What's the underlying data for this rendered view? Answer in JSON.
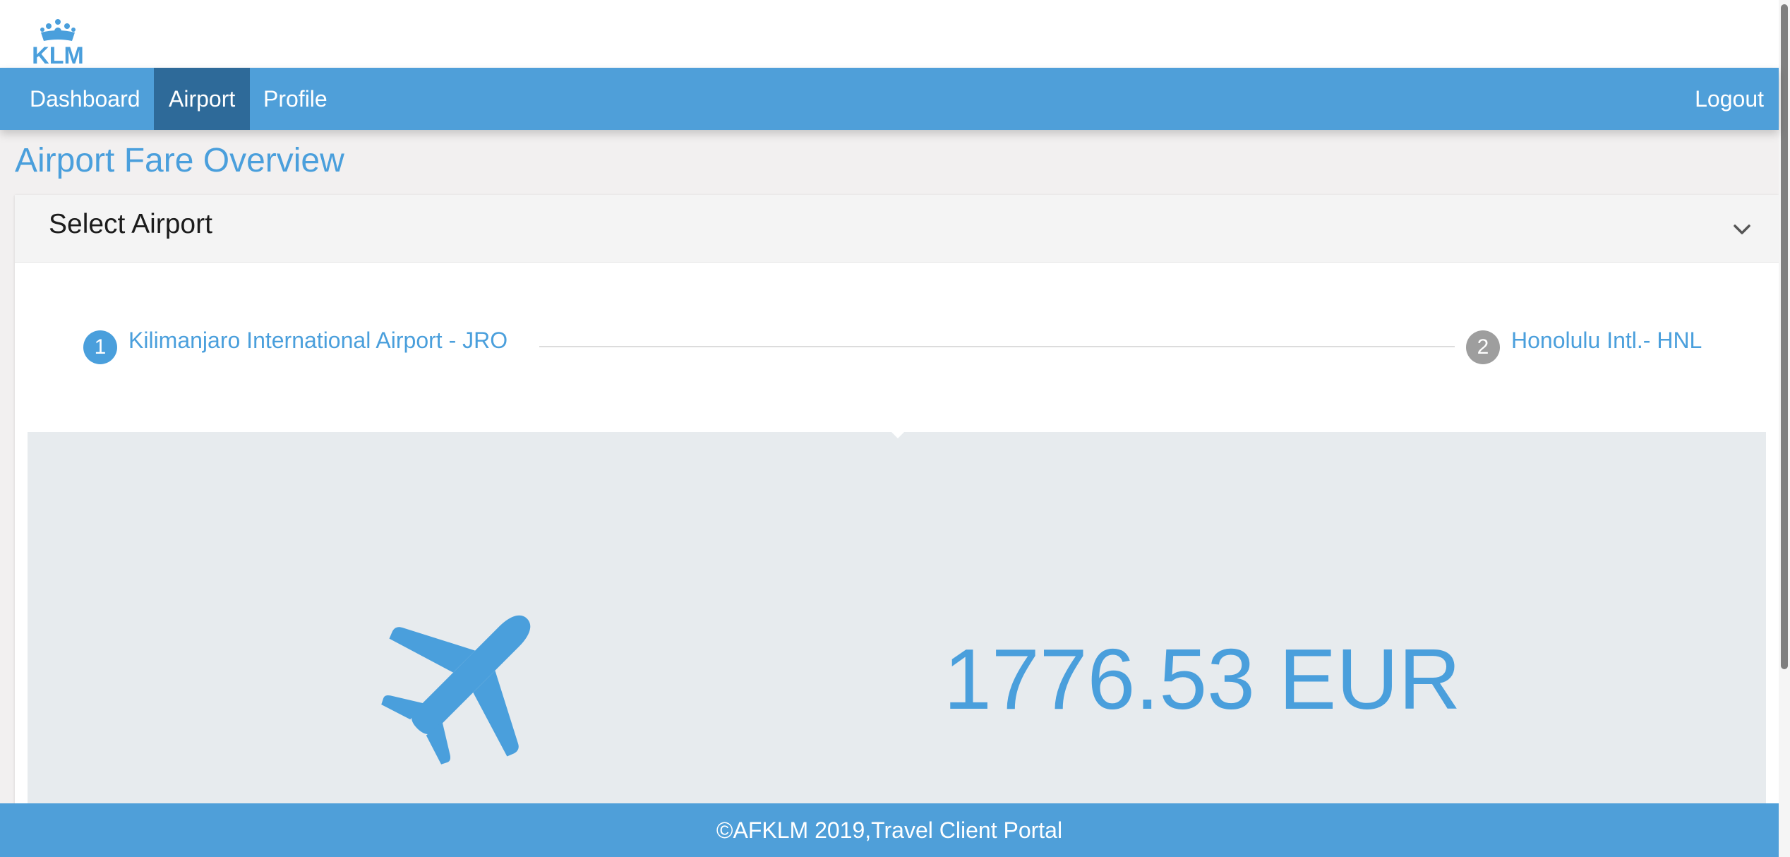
{
  "logo": {
    "text": "KLM",
    "icon": "klm-crown-logo"
  },
  "nav": {
    "items": [
      {
        "label": "Dashboard"
      },
      {
        "label": "Airport"
      },
      {
        "label": "Profile"
      }
    ],
    "active": "Airport",
    "logout_label": "Logout"
  },
  "page": {
    "title": "Airport Fare Overview"
  },
  "select_panel": {
    "header": "Select Airport",
    "chevron_icon": "chevron-down-icon",
    "steps": [
      {
        "number": "1",
        "label": "Kilimanjaro International Airport - JRO"
      },
      {
        "number": "2",
        "label": "Honolulu Intl.- HNL"
      }
    ]
  },
  "fare": {
    "icon": "airplane-icon",
    "amount": "1776.53 EUR"
  },
  "footer": {
    "text": "©AFKLM 2019,Travel Client Portal"
  },
  "colors": {
    "primary": "#4f9fd9",
    "active_nav": "#2e6a99",
    "accent_text": "#4a9fdc",
    "step_inactive": "#9e9e9e",
    "panel_bg": "#e7ebee"
  }
}
